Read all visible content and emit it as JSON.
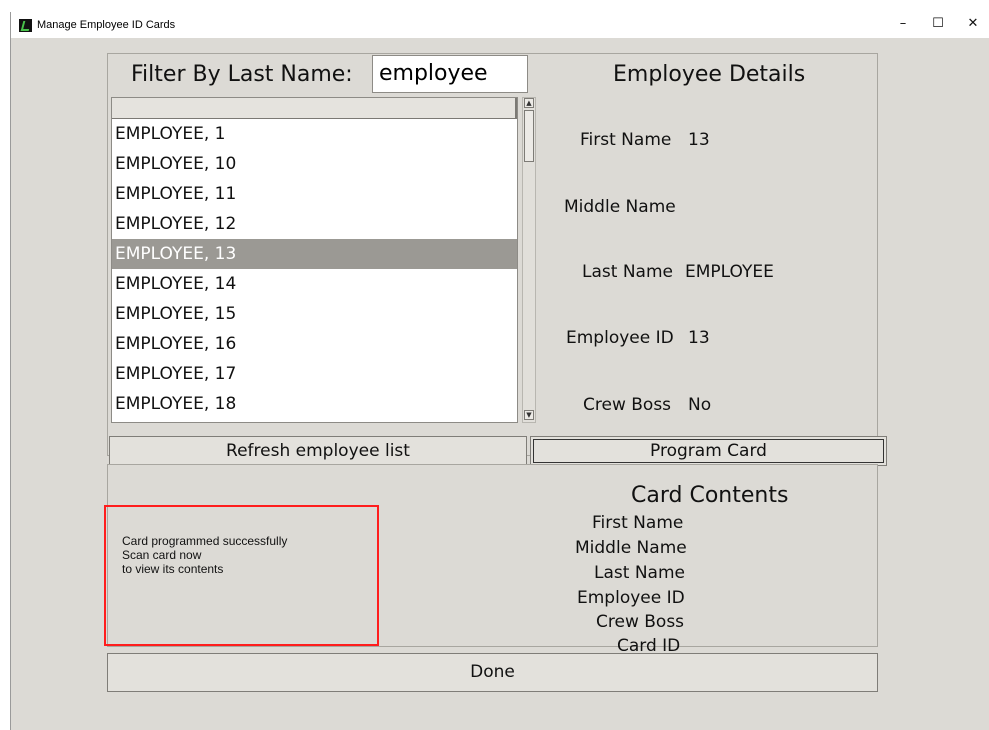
{
  "window": {
    "title": "Manage Employee ID Cards",
    "minimize_glyph": "–",
    "maximize_glyph": "☐",
    "close_glyph": "✕"
  },
  "filter": {
    "label": "Filter By Last Name:",
    "value": "employee"
  },
  "employee_list": {
    "items": [
      "EMPLOYEE, 1",
      "EMPLOYEE, 10",
      "EMPLOYEE, 11",
      "EMPLOYEE, 12",
      "EMPLOYEE, 13",
      "EMPLOYEE, 14",
      "EMPLOYEE, 15",
      "EMPLOYEE, 16",
      "EMPLOYEE, 17",
      "EMPLOYEE, 18"
    ],
    "selected_index": 4,
    "scroll_up_glyph": "▲",
    "scroll_down_glyph": "▼"
  },
  "details": {
    "title": "Employee Details",
    "first_name_label": "First Name",
    "first_name_value": "13",
    "middle_name_label": "Middle Name",
    "middle_name_value": "",
    "last_name_label": "Last Name",
    "last_name_value": "EMPLOYEE",
    "employee_id_label": "Employee ID",
    "employee_id_value": "13",
    "crew_boss_label": "Crew Boss",
    "crew_boss_value": "No"
  },
  "buttons": {
    "refresh": "Refresh employee list",
    "program": "Program Card",
    "done": "Done"
  },
  "status": {
    "line1": "Card programmed successfully",
    "line2": "Scan card now",
    "line3": "to view its contents",
    "highlight_color": "#ff1d1d"
  },
  "card_contents": {
    "title": "Card Contents",
    "first_name": "First Name",
    "middle_name": "Middle Name",
    "last_name": "Last Name",
    "employee_id": "Employee ID",
    "crew_boss": "Crew Boss",
    "card_id": "Card ID"
  }
}
